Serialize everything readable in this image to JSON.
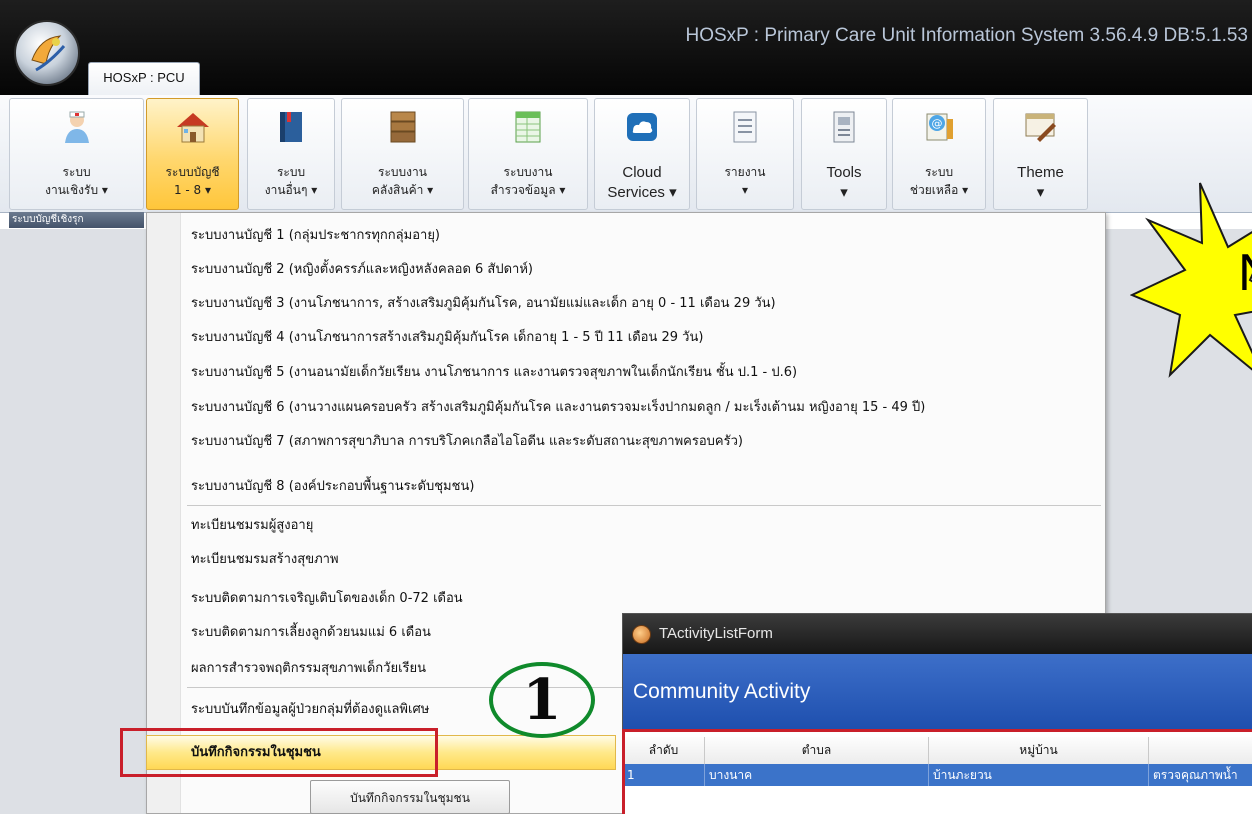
{
  "window": {
    "title": "HOSxP : Primary Care Unit Information System 3.56.4.9 DB:5.1.53",
    "tab": "HOSxP : PCU"
  },
  "ribbon": {
    "buttons": [
      {
        "label": "ระบบ\nงานเชิงรับ ▾",
        "icon": "nurse-icon"
      },
      {
        "label": "ระบบบัญชี\n1 - 8 ▾",
        "icon": "house-icon",
        "active": true
      },
      {
        "label": "ระบบ\nงานอื่นๆ ▾",
        "icon": "book-icon"
      },
      {
        "label": "ระบบงาน\nคลังสินค้า ▾",
        "icon": "boxes-icon"
      },
      {
        "label": "ระบบงาน\nสำรวจข้อมูล ▾",
        "icon": "spreadsheet-icon"
      },
      {
        "label": "Cloud\nServices ▾",
        "icon": "cloud-icon"
      },
      {
        "label": "รายงาน\n▾",
        "icon": "report-icon"
      },
      {
        "label": "Tools\n▾",
        "icon": "tools-icon"
      },
      {
        "label": "ระบบ\nช่วยเหลือ ▾",
        "icon": "help-icon"
      },
      {
        "label": "Theme\n▾",
        "icon": "theme-icon"
      }
    ],
    "group_label": "ระบบบัญชีเชิงรุก"
  },
  "menu": {
    "items": [
      "ระบบงานบัญชี 1 (กลุ่มประชากรทุกกลุ่มอายุ)",
      "ระบบงานบัญชี 2 (หญิงตั้งครรภ์และหญิงหลังคลอด 6 สัปดาห์)",
      "ระบบงานบัญชี 3 (งานโภชนาการ, สร้างเสริมภูมิคุ้มกันโรค, อนามัยแม่และเด็ก อายุ 0 - 11 เดือน 29 วัน)",
      "ระบบงานบัญชี 4 (งานโภชนาการสร้างเสริมภูมิคุ้มกันโรค เด็กอายุ 1 - 5 ปี 11 เดือน 29 วัน)",
      "ระบบงานบัญชี 5 (งานอนามัยเด็กวัยเรียน งานโภชนาการ และงานตรวจสุขภาพในเด็กนักเรียน ชั้น ป.1 - ป.6)",
      "ระบบงานบัญชี 6 (งานวางแผนครอบครัว สร้างเสริมภูมิคุ้มกันโรค และงานตรวจมะเร็งปากมดลูก / มะเร็งเต้านม หญิงอายุ 15 - 49 ปี)",
      "ระบบงานบัญชี 7 (สภาพการสุขาภิบาล การบริโภคเกลือไอโอดีน และระดับสถานะสุขภาพครอบครัว)",
      "ระบบงานบัญชี 8 (องค์ประกอบพื้นฐานระดับชุมชน)",
      "ทะเบียนชมรมผู้สูงอายุ",
      "ทะเบียนชมรมสร้างสุขภาพ",
      "ระบบติดตามการเจริญเติบโตของเด็ก 0-72 เดือน",
      "ระบบติดตามการเลี้ยงลูกด้วยนมแม่ 6 เดือน",
      "ผลการสำรวจพฤติกรรมสุขภาพเด็กวัยเรียน",
      "ระบบบันทึกข้อมูลผู้ป่วยกลุ่มที่ต้องดูแลพิเศษ"
    ],
    "highlighted_item": "บันทึกกิจกรรมในชุมชน"
  },
  "annotation": {
    "step_number": "1",
    "star_text": "N"
  },
  "status_button": "บันทึกกิจกรรมในชุมชน",
  "activity_form": {
    "title": "TActivityListForm",
    "header": "Community Activity",
    "columns": [
      "ลำดับ",
      "ตำบล",
      "หมู่บ้าน",
      ""
    ],
    "rows": [
      [
        "1",
        "บางนาค",
        "บ้านภะยวน",
        "ตรวจคุณภาพน้ำ"
      ]
    ]
  },
  "colors": {
    "accent_red": "#c91f2a",
    "badge_green": "#0f8a2b",
    "selection_blue": "#3b73c9",
    "menu_highlight": "#ffe98a",
    "star_yellow": "#ffff00"
  }
}
